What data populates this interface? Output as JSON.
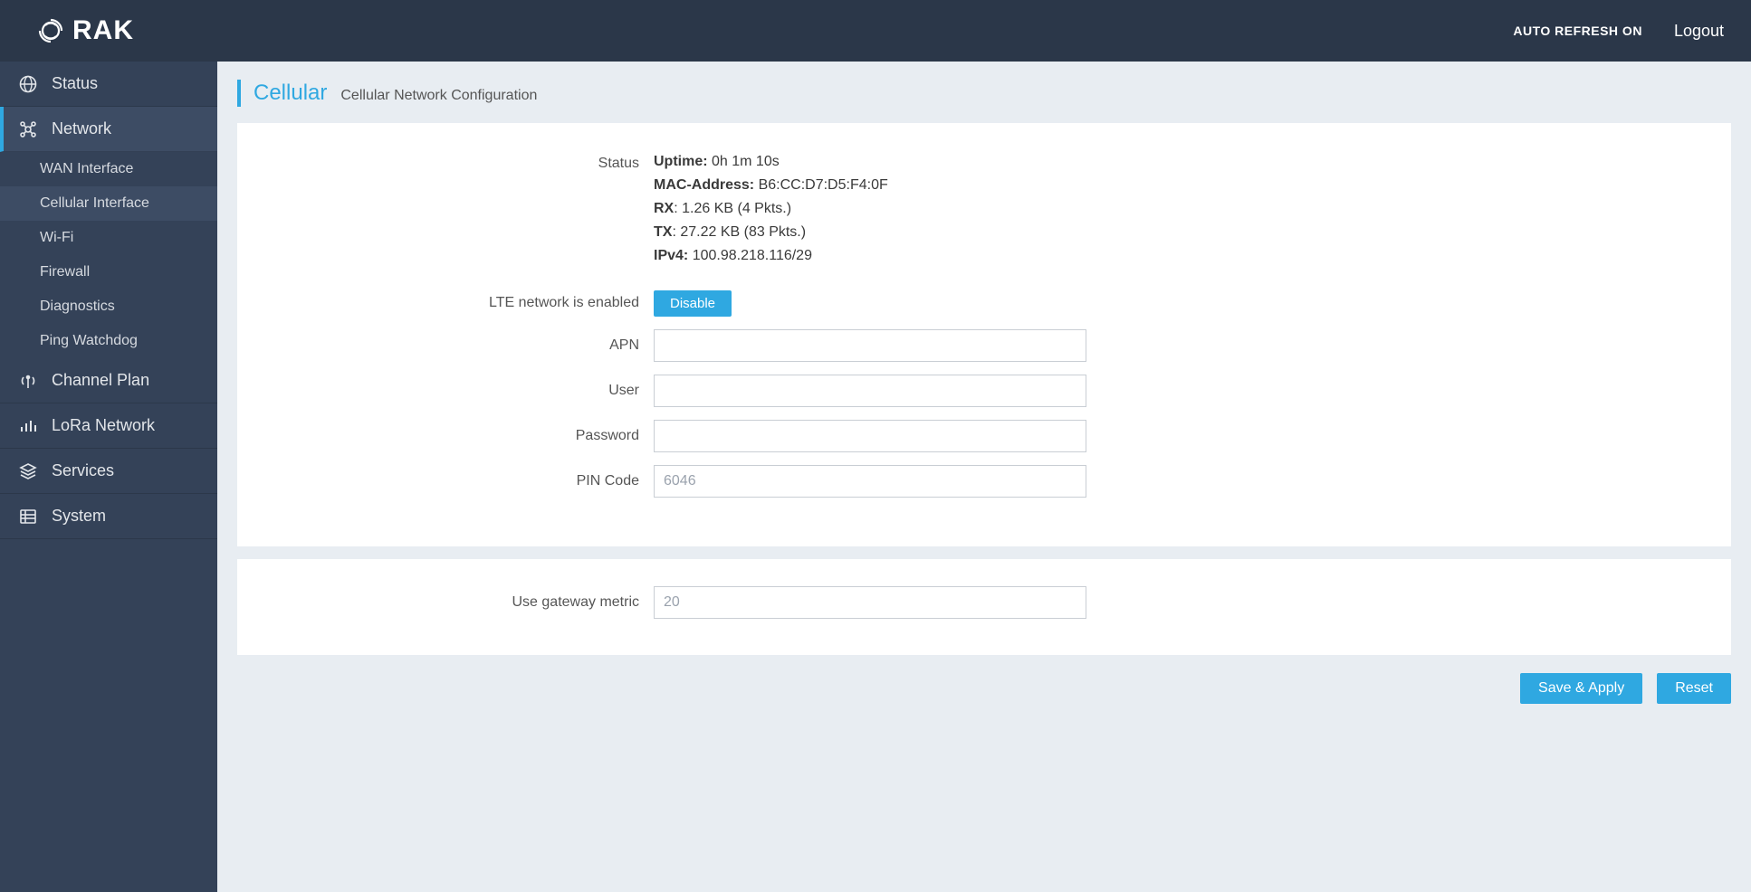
{
  "header": {
    "brand": "RAK",
    "auto_refresh": "AUTO REFRESH ON",
    "logout": "Logout"
  },
  "sidebar": {
    "items": [
      {
        "label": "Status",
        "icon": "globe-icon"
      },
      {
        "label": "Network",
        "icon": "network-icon",
        "active": true,
        "children": [
          {
            "label": "WAN Interface"
          },
          {
            "label": "Cellular Interface",
            "active": true
          },
          {
            "label": "Wi-Fi"
          },
          {
            "label": "Firewall"
          },
          {
            "label": "Diagnostics"
          },
          {
            "label": "Ping Watchdog"
          }
        ]
      },
      {
        "label": "Channel Plan",
        "icon": "antenna-icon"
      },
      {
        "label": "LoRa Network",
        "icon": "bars-icon"
      },
      {
        "label": "Services",
        "icon": "stack-icon"
      },
      {
        "label": "System",
        "icon": "grid-icon"
      }
    ]
  },
  "page": {
    "title": "Cellular",
    "subtitle": "Cellular Network Configuration"
  },
  "status": {
    "label": "Status",
    "uptime_key": "Uptime:",
    "uptime_val": "0h 1m 10s",
    "mac_key": "MAC-Address:",
    "mac_val": "B6:CC:D7:D5:F4:0F",
    "rx_key": "RX",
    "rx_val": ": 1.26 KB (4 Pkts.)",
    "tx_key": "TX",
    "tx_val": ": 27.22 KB (83 Pkts.)",
    "ipv4_key": "IPv4:",
    "ipv4_val": "100.98.218.116/29"
  },
  "form": {
    "lte_label": "LTE network is enabled",
    "disable_btn": "Disable",
    "apn_label": "APN",
    "apn_value": "",
    "user_label": "User",
    "user_value": "",
    "password_label": "Password",
    "password_value": "",
    "pin_label": "PIN Code",
    "pin_placeholder": "6046",
    "pin_value": "",
    "metric_label": "Use gateway metric",
    "metric_placeholder": "20",
    "metric_value": ""
  },
  "actions": {
    "save": "Save & Apply",
    "reset": "Reset"
  }
}
